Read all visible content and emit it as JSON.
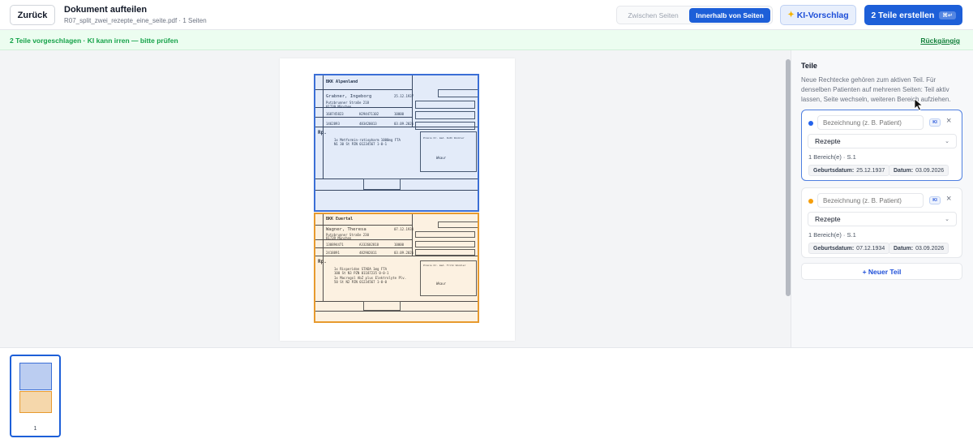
{
  "header": {
    "back_label": "Zurück",
    "title": "Dokument aufteilen",
    "subtitle": "R07_split_zwei_rezepte_eine_seite.pdf · 1 Seiten",
    "mode_between": "Zwischen Seiten",
    "mode_within": "Innerhalb von Seiten",
    "ki_label": "KI-Vorschlag",
    "create_label": "2 Teile erstellen",
    "create_shortcut": "⌘↵"
  },
  "banner": {
    "text": "2 Teile vorgeschlagen · KI kann irren — bitte prüfen",
    "undo": "Rückgängig"
  },
  "document": {
    "rx1": {
      "insurer": "BKK Alpenland",
      "patient_name": "Grabner, Ingeborg",
      "dob": "25.12.1937",
      "street": "Putzbrunner Straße 218",
      "city": "81739 München",
      "id1": "168745823",
      "id2": "H294471102",
      "status": "10000",
      "bsnr": "1462893",
      "lanr": "483420013",
      "date": "03.09.2026",
      "rx_label": "Rp.",
      "med1": "1x Metformin-ratiopharm 1000mg FTA",
      "med1_line2": "N1 30 St   PZN 01234567   1-0-1",
      "doctor": "Praxis Dr. med. Ruth Winkler",
      "noctu": "Wkaur"
    },
    "rx2": {
      "insurer": "BKK Euertal",
      "patient_name": "Wagner, Theresa",
      "dob": "07.12.1934",
      "street": "Putzbrunner Straße 230",
      "city": "81739 München",
      "id1": "130894471",
      "id2": "A332602818",
      "status": "10000",
      "bsnr": "2418891",
      "lanr": "482902011",
      "date": "03.09.2026",
      "rx_label": "Rp.",
      "med1": "1x Risperidon STADA 1mg FTA",
      "med1_line2": "100 St  N3  PZN 01187235   0-0-1",
      "med2": "1x Macrogol AbZ plus Elektrolyte Plv.",
      "med2_line2": "50 St N2  PZN 01234567   1-0-0",
      "doctor": "Praxis Dr. med. Fritz Winkler",
      "noctu": "Wkaur"
    }
  },
  "panel": {
    "title": "Teile",
    "help": "Neue Rechtecke gehören zum aktiven Teil. Für denselben Patienten auf mehreren Seiten: Teil aktiv lassen, Seite wechseln, weiteren Bereich aufziehen.",
    "parts": [
      {
        "color": "#2563eb",
        "name_placeholder": "Bezeichnung (z. B. Patient)",
        "ki": "KI",
        "type": "Rezepte",
        "meta": "1 Bereich(e) · S.1",
        "dob_label": "Geburtsdatum:",
        "dob": "25.12.1937",
        "date_label": "Datum:",
        "date": "03.09.2026"
      },
      {
        "color": "#f59e0b",
        "name_placeholder": "Bezeichnung (z. B. Patient)",
        "ki": "KI",
        "type": "Rezepte",
        "meta": "1 Bereich(e) · S.1",
        "dob_label": "Geburtsdatum:",
        "dob": "07.12.1934",
        "date_label": "Datum:",
        "date": "03.09.2026"
      }
    ],
    "new_part": "+ Neuer Teil"
  },
  "thumbnails": [
    {
      "page_number": "1"
    }
  ]
}
